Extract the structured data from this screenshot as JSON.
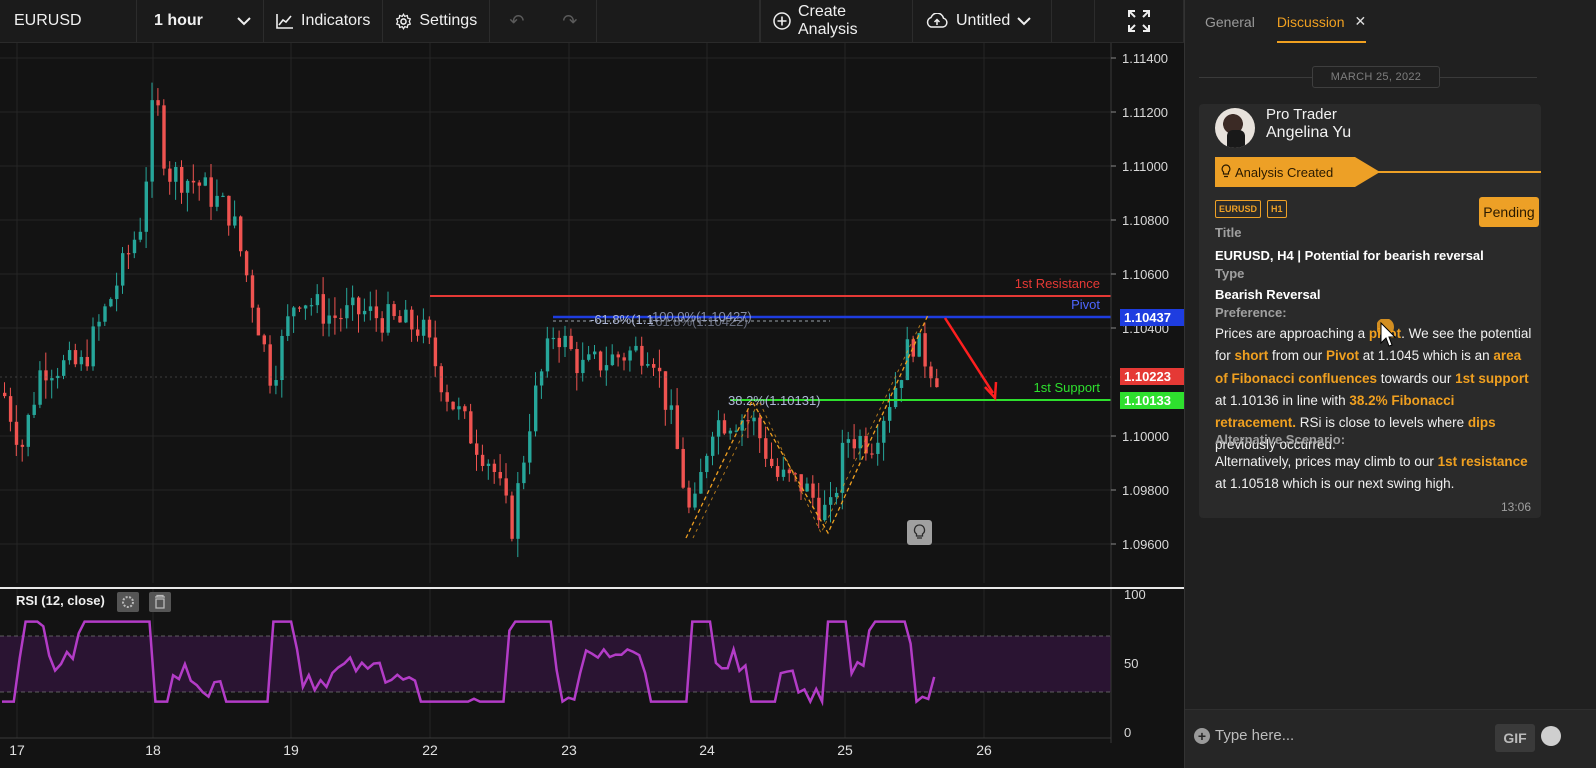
{
  "toolbar": {
    "symbol": "EURUSD",
    "interval": "1 hour",
    "indicators_label": "Indicators",
    "settings_label": "Settings",
    "create_analysis_label": "Create Analysis",
    "layout_label": "Untitled"
  },
  "chart": {
    "price_ticks": [
      "1.11400",
      "1.11200",
      "1.11000",
      "1.10800",
      "1.10600",
      "1.10400",
      "1.10000",
      "1.09800",
      "1.09600"
    ],
    "date_ticks": [
      "17",
      "18",
      "19",
      "22",
      "23",
      "24",
      "25",
      "26"
    ],
    "levels": {
      "resistance_label": "1st Resistance",
      "pivot_label": "Pivot",
      "support_label": "1st Support",
      "pivot_price": "1.10437",
      "current_price": "1.10223",
      "support_price": "1.10133"
    },
    "fib_labels": {
      "fib_618": "-61.8%(1.1",
      "fib_overlap": "100.0%(1.10427)",
      "fib_overlap2": "161.8%(1.10422)",
      "fib_382": "38.2%(1.10131)"
    },
    "colors": {
      "up": "#26a69a",
      "down": "#ef5350",
      "resistance": "#e53935",
      "pivot": "#1e3de0",
      "support": "#2ee02e",
      "rsi": "#b33cc7"
    }
  },
  "chart_data": {
    "type": "candlestick",
    "symbol": "EURUSD",
    "interval": "1 hour",
    "x_labels": [
      "17",
      "18",
      "19",
      "22",
      "23",
      "24",
      "25",
      "26"
    ],
    "ylim": [
      1.0955,
      1.1145
    ],
    "levels": {
      "1st Resistance": 1.10518,
      "Pivot": 1.10437,
      "1st Support": 1.10133,
      "Current": 1.10223
    },
    "rsi": {
      "label": "RSI (12, close)",
      "ylim": [
        0,
        100
      ],
      "ticks": [
        "100",
        "50",
        "0"
      ],
      "bands": [
        30,
        70
      ]
    }
  },
  "rsi_panel": {
    "title": "RSI (12, close)",
    "ticks": [
      "100",
      "50",
      "0"
    ]
  },
  "panel": {
    "tabs": [
      "General",
      "Discussion"
    ],
    "date": "MARCH 25, 2022",
    "user_role": "Pro Trader",
    "user_name": "Angelina Yu",
    "created_label": "Analysis Created",
    "tags": [
      "EURUSD",
      "H1"
    ],
    "status": "Pending",
    "title_label": "Title",
    "title_value": "EURUSD, H4 | Potential for bearish reversal",
    "type_label": "Type",
    "type_value": "Bearish Reversal",
    "preference_label": "Preference:",
    "alt_label": "Alternative Scenario:",
    "time": "13:06",
    "composer_placeholder": "Type here...",
    "gif_label": "GIF"
  },
  "preference_text": [
    {
      "t": "Prices are approaching a "
    },
    {
      "t": "pivot",
      "h": true
    },
    {
      "t": ". We see the potential for "
    },
    {
      "t": "short",
      "h": true
    },
    {
      "t": " from our "
    },
    {
      "t": "Pivot",
      "h": true
    },
    {
      "t": " at 1.1045 which is an "
    },
    {
      "t": "area of Fibonacci confluences",
      "h": true
    },
    {
      "t": " towards our "
    },
    {
      "t": "1st support",
      "h": true
    },
    {
      "t": " at 1.10136 in line with "
    },
    {
      "t": "38.2% Fibonacci retracement.",
      "h": true
    },
    {
      "t": " RSi is close to levels where "
    },
    {
      "t": "dips",
      "h": true
    },
    {
      "t": " previously occurred."
    }
  ],
  "alternative_text": [
    {
      "t": "Alternatively, prices may climb to our "
    },
    {
      "t": "1st resistance",
      "h": true
    },
    {
      "t": " at 1.10518 which is our next swing high."
    }
  ]
}
